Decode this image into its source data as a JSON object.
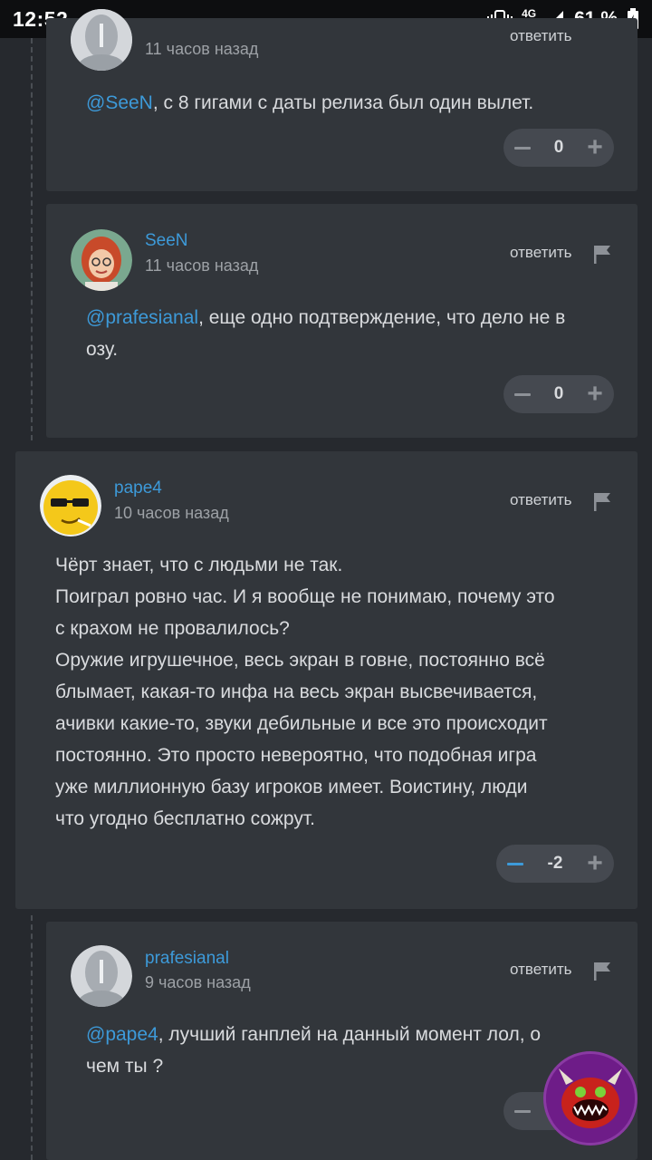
{
  "statusbar": {
    "time": "12:52",
    "network": "4G",
    "battery": "61 %"
  },
  "comments": [
    {
      "timestamp": "11 часов назад",
      "reply_label": "ответить",
      "mention": "@SeeN",
      "text": ", с 8 гигами с даты релиза был один вылет.",
      "score": "0"
    },
    {
      "username": "SeeN",
      "timestamp": "11 часов назад",
      "reply_label": "ответить",
      "mention": "@prafesianal",
      "text_line1": ", еще одно подтверждение, что дело не в",
      "text_line2": "озу.",
      "score": "0"
    },
    {
      "username": "pape4",
      "timestamp": "10 часов назад",
      "reply_label": "ответить",
      "lines": [
        "Чёрт знает, что с людьми не так.",
        "Поиграл ровно час. И я вообще не понимаю, почему это",
        "с крахом не провалилось?",
        "Оружие игрушечное, весь экран в говне, постоянно всё",
        "блымает, какая-то инфа на весь экран высвечивается,",
        "ачивки какие-то, звуки дебильные и все это происходит",
        "постоянно. Это просто невероятно, что подобная игра",
        "уже миллионную базу игроков имеет. Воистину, люди",
        "что угодно бесплатно сожрут."
      ],
      "score": "-2"
    },
    {
      "username": "prafesianal",
      "timestamp": "9 часов назад",
      "reply_label": "ответить",
      "mention": "@pape4",
      "text_line1": ", лучший ганплей на данный момент лол, о",
      "text_line2": "чем ты ?"
    }
  ],
  "colors": {
    "accent": "#3d9ad9",
    "card": "#32363b",
    "background": "#26292e"
  }
}
